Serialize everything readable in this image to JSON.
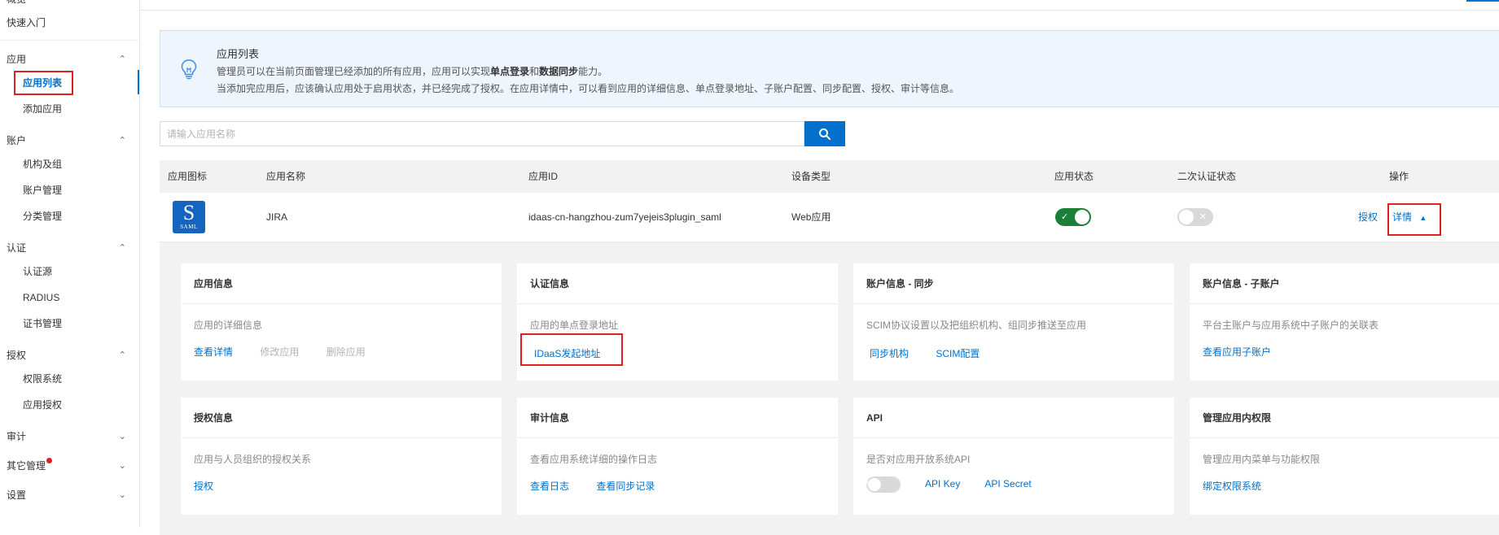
{
  "sidebar": {
    "top_partial": "概览",
    "quick_start": "快速入门",
    "groups": [
      {
        "label": "应用",
        "chevron": "^",
        "items": [
          "应用列表",
          "添加应用"
        ]
      },
      {
        "label": "账户",
        "chevron": "^",
        "items": [
          "机构及组",
          "账户管理",
          "分类管理"
        ]
      },
      {
        "label": "认证",
        "chevron": "^",
        "items": [
          "认证源",
          "RADIUS",
          "证书管理"
        ]
      },
      {
        "label": "授权",
        "chevron": "^",
        "items": [
          "权限系统",
          "应用授权"
        ]
      },
      {
        "label": "审计",
        "chevron": "v",
        "items": []
      },
      {
        "label": "其它管理",
        "chevron": "v",
        "items": []
      },
      {
        "label": "设置",
        "chevron": "v",
        "items": []
      }
    ],
    "active_item": "应用列表"
  },
  "notice": {
    "title": "应用列表",
    "line1_a": "管理员可以在当前页面管理已经添加的所有应用，应用可以实现",
    "line1_b": "单点登录",
    "line1_c": "和",
    "line1_d": "数据同步",
    "line1_e": "能力。",
    "line2": "当添加完应用后，应该确认应用处于启用状态，并已经完成了授权。在应用详情中，可以看到应用的详细信息、单点登录地址、子账户配置、同步配置、授权、审计等信息。"
  },
  "search": {
    "placeholder": "请输入应用名称",
    "value": ""
  },
  "table": {
    "headers": [
      "应用图标",
      "应用名称",
      "应用ID",
      "设备类型",
      "应用状态",
      "二次认证状态",
      "操作"
    ],
    "rows": [
      {
        "icon_letter": "S",
        "icon_caption": "SAML",
        "name": "JIRA",
        "app_id": "idaas-cn-hangzhou-zum7yejeis3plugin_saml",
        "device_type": "Web应用",
        "status_on": true,
        "mfa_on": false,
        "action_authorize": "授权",
        "action_detail": "详情"
      }
    ]
  },
  "cards": [
    {
      "title": "应用信息",
      "desc": "应用的详细信息",
      "actions": [
        "查看详情",
        "修改应用",
        "删除应用"
      ]
    },
    {
      "title": "认证信息",
      "desc": "应用的单点登录地址",
      "actions": [
        "IDaaS发起地址"
      ]
    },
    {
      "title": "账户信息 - 同步",
      "desc": "SCIM协议设置以及把组织机构、组同步推送至应用",
      "actions": [
        "同步机构",
        "SCIM配置"
      ]
    },
    {
      "title": "账户信息 - 子账户",
      "desc": "平台主账户与应用系统中子账户的关联表",
      "actions": [
        "查看应用子账户"
      ]
    },
    {
      "title": "授权信息",
      "desc": "应用与人员组织的授权关系",
      "actions": [
        "授权"
      ]
    },
    {
      "title": "审计信息",
      "desc": "查看应用系统详细的操作日志",
      "actions": [
        "查看日志",
        "查看同步记录"
      ]
    },
    {
      "title": "API",
      "desc": "是否对应用开放系统API",
      "actions": [
        "API Key",
        "API Secret"
      ]
    },
    {
      "title": "管理应用内权限",
      "desc": "管理应用内菜单与功能权限",
      "actions": [
        "绑定权限系统"
      ]
    }
  ],
  "colors": {
    "accent": "#0070cc",
    "toggle_on": "#1a7f37",
    "highlight": "#e02020"
  }
}
